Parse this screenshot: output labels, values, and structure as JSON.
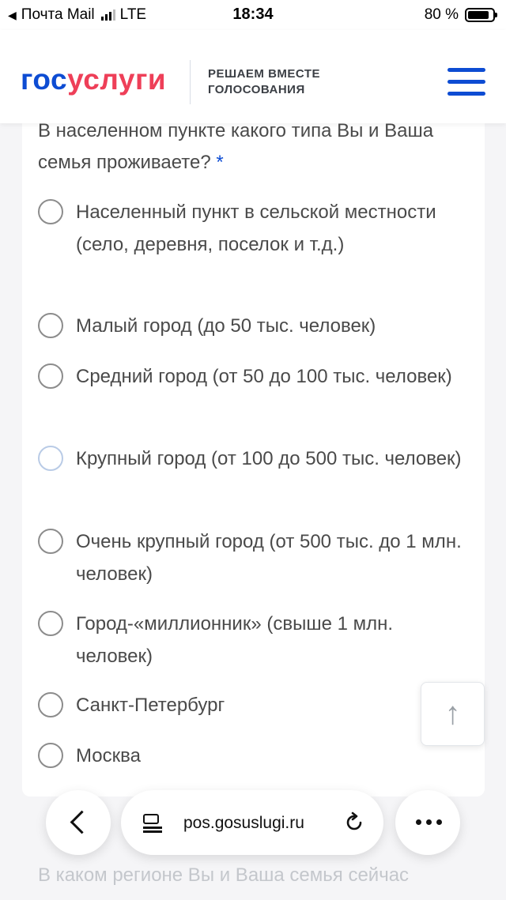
{
  "status_bar": {
    "carrier": "Почта Mail",
    "network": "LTE",
    "time": "18:34",
    "battery": "80 %"
  },
  "header": {
    "logo_part1": "гос",
    "logo_part2": "услуги",
    "tagline_line1": "РЕШАЕМ ВМЕСТЕ",
    "tagline_line2": "ГОЛОСОВАНИЯ"
  },
  "question": {
    "text": "В населенном пункте какого типа Вы и Ваша семья проживаете?",
    "required_mark": "*",
    "options": [
      {
        "label": "Населенный пункт в сельской местности (село, деревня, поселок и т.д.)"
      },
      {
        "label": "Малый город (до 50 тыс. человек)"
      },
      {
        "label": "Средний город (от 50 до 100 тыс. человек)"
      },
      {
        "label": "Крупный город (от 100 до 500 тыс. человек)"
      },
      {
        "label": "Очень крупный город (от 500 тыс. до 1 млн. человек)"
      },
      {
        "label": "Город-«миллионник» (свыше 1 млн. человек)"
      },
      {
        "label": "Санкт-Петербург"
      },
      {
        "label": "Москва"
      }
    ]
  },
  "browser": {
    "url": "pos.gosuslugi.ru"
  },
  "next_question": {
    "text": "В каком регионе Вы и Ваша семья сейчас"
  },
  "icons": {
    "back": "chevron-left-icon",
    "page": "page-icon",
    "reload": "reload-icon",
    "more": "more-icon",
    "scroll_top": "arrow-up-icon",
    "menu": "hamburger-icon"
  },
  "colors": {
    "brand_blue": "#0d4cd3",
    "brand_red": "#ee3f58"
  }
}
